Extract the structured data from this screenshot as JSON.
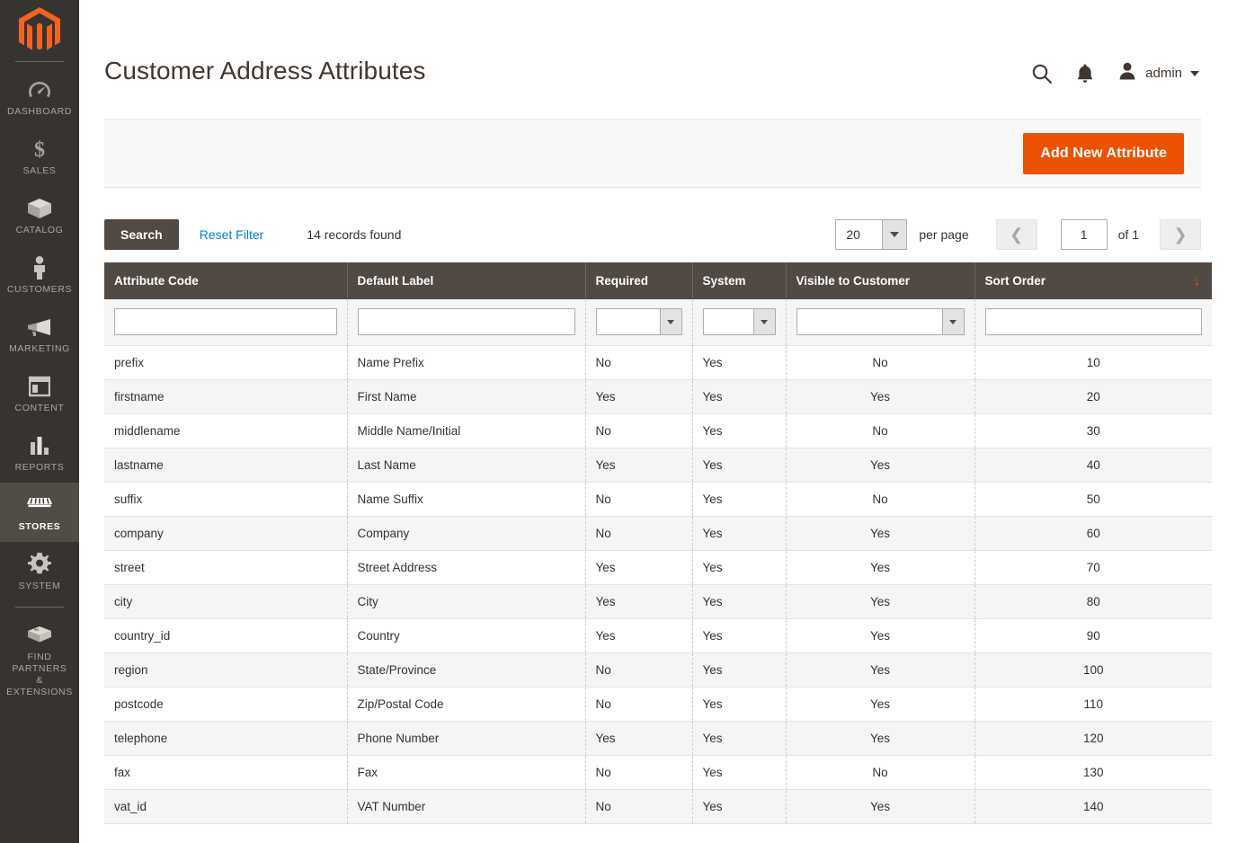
{
  "sidebar": {
    "logo_name": "magento-logo",
    "items": [
      {
        "label": "DASHBOARD",
        "icon": "dashboard-icon",
        "active": false
      },
      {
        "label": "SALES",
        "icon": "dollar-icon",
        "active": false
      },
      {
        "label": "CATALOG",
        "icon": "box-icon",
        "active": false
      },
      {
        "label": "CUSTOMERS",
        "icon": "person-icon",
        "active": false
      },
      {
        "label": "MARKETING",
        "icon": "megaphone-icon",
        "active": false
      },
      {
        "label": "CONTENT",
        "icon": "layout-icon",
        "active": false
      },
      {
        "label": "REPORTS",
        "icon": "bar-chart-icon",
        "active": false
      },
      {
        "label": "STORES",
        "icon": "storefront-icon",
        "active": true
      },
      {
        "label": "SYSTEM",
        "icon": "gear-icon",
        "active": false
      },
      {
        "label": "FIND PARTNERS\n& EXTENSIONS",
        "icon": "extension-icon",
        "active": false
      }
    ]
  },
  "header": {
    "title": "Customer Address Attributes",
    "search_icon": "search-icon",
    "notifications_icon": "bell-icon",
    "avatar_icon": "user-avatar-icon",
    "admin_label": "admin"
  },
  "page_actions": {
    "add_new_label": "Add New Attribute"
  },
  "grid_toolbar": {
    "search_label": "Search",
    "reset_filter_label": "Reset Filter",
    "records_found": "14 records found",
    "per_page_value": "20",
    "per_page_label": "per page",
    "page_value": "1",
    "of_label": "of 1",
    "prev_icon": "chevron-left-icon",
    "next_icon": "chevron-right-icon"
  },
  "grid": {
    "columns": [
      {
        "label": "Attribute Code",
        "filter": "text",
        "sorted": false
      },
      {
        "label": "Default Label",
        "filter": "text",
        "sorted": false
      },
      {
        "label": "Required",
        "filter": "select",
        "sorted": false
      },
      {
        "label": "System",
        "filter": "select",
        "sorted": false
      },
      {
        "label": "Visible to Customer",
        "filter": "select",
        "sorted": false
      },
      {
        "label": "Sort Order",
        "filter": "text",
        "sorted": true,
        "sort_dir": "↓"
      }
    ],
    "filters": {
      "attribute_code": "",
      "default_label": "",
      "required": "",
      "system": "",
      "visible_to_customer": "",
      "sort_order": ""
    },
    "rows": [
      {
        "code": "prefix",
        "label": "Name Prefix",
        "required": "No",
        "system": "Yes",
        "visible": "No",
        "sort": "10"
      },
      {
        "code": "firstname",
        "label": "First Name",
        "required": "Yes",
        "system": "Yes",
        "visible": "Yes",
        "sort": "20"
      },
      {
        "code": "middlename",
        "label": "Middle Name/Initial",
        "required": "No",
        "system": "Yes",
        "visible": "No",
        "sort": "30"
      },
      {
        "code": "lastname",
        "label": "Last Name",
        "required": "Yes",
        "system": "Yes",
        "visible": "Yes",
        "sort": "40"
      },
      {
        "code": "suffix",
        "label": "Name Suffix",
        "required": "No",
        "system": "Yes",
        "visible": "No",
        "sort": "50"
      },
      {
        "code": "company",
        "label": "Company",
        "required": "No",
        "system": "Yes",
        "visible": "Yes",
        "sort": "60"
      },
      {
        "code": "street",
        "label": "Street Address",
        "required": "Yes",
        "system": "Yes",
        "visible": "Yes",
        "sort": "70"
      },
      {
        "code": "city",
        "label": "City",
        "required": "Yes",
        "system": "Yes",
        "visible": "Yes",
        "sort": "80"
      },
      {
        "code": "country_id",
        "label": "Country",
        "required": "Yes",
        "system": "Yes",
        "visible": "Yes",
        "sort": "90"
      },
      {
        "code": "region",
        "label": "State/Province",
        "required": "No",
        "system": "Yes",
        "visible": "Yes",
        "sort": "100"
      },
      {
        "code": "postcode",
        "label": "Zip/Postal Code",
        "required": "No",
        "system": "Yes",
        "visible": "Yes",
        "sort": "110"
      },
      {
        "code": "telephone",
        "label": "Phone Number",
        "required": "Yes",
        "system": "Yes",
        "visible": "Yes",
        "sort": "120"
      },
      {
        "code": "fax",
        "label": "Fax",
        "required": "No",
        "system": "Yes",
        "visible": "No",
        "sort": "130"
      },
      {
        "code": "vat_id",
        "label": "VAT Number",
        "required": "No",
        "system": "Yes",
        "visible": "Yes",
        "sort": "140"
      }
    ]
  },
  "colors": {
    "accent_orange": "#eb5202",
    "sidebar_bg": "#373330",
    "sidebar_active_bg": "#524c47",
    "header_bg": "#514943",
    "link_blue": "#007bdb",
    "row_alt_bg": "#f5f5f5"
  }
}
